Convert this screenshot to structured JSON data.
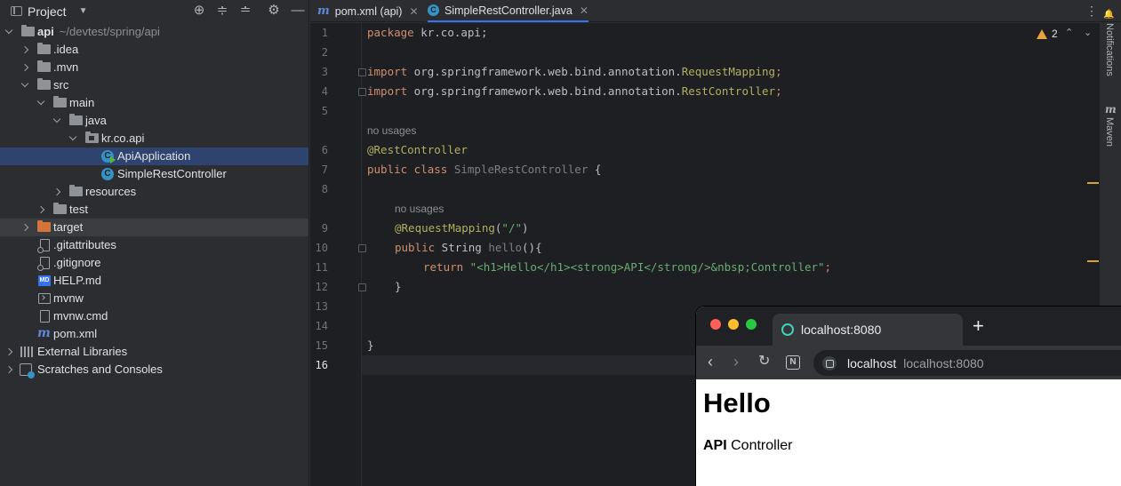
{
  "project_panel": {
    "title": "Project",
    "tree": [
      {
        "label": "api",
        "extra": "~/devtest/spring/api"
      },
      {
        "label": ".idea"
      },
      {
        "label": ".mvn"
      },
      {
        "label": "src"
      },
      {
        "label": "main"
      },
      {
        "label": "java"
      },
      {
        "label": "kr.co.api"
      },
      {
        "label": "ApiApplication"
      },
      {
        "label": "SimpleRestController"
      },
      {
        "label": "resources"
      },
      {
        "label": "test"
      },
      {
        "label": "target"
      },
      {
        "label": ".gitattributes"
      },
      {
        "label": ".gitignore"
      },
      {
        "label": "HELP.md"
      },
      {
        "label": "mvnw"
      },
      {
        "label": "mvnw.cmd"
      },
      {
        "label": "pom.xml"
      },
      {
        "label": "External Libraries"
      },
      {
        "label": "Scratches and Consoles"
      }
    ]
  },
  "tabs": [
    {
      "label": "pom.xml (api)",
      "icon": "maven-icon"
    },
    {
      "label": "SimpleRestController.java",
      "icon": "class-icon"
    }
  ],
  "editor": {
    "warning_count": "2",
    "line_numbers": [
      "1",
      "2",
      "3",
      "4",
      "5",
      "6",
      "7",
      "8",
      "9",
      "10",
      "11",
      "12",
      "13",
      "14",
      "15",
      "16"
    ],
    "hint_usages": "no usages",
    "lines": {
      "l1_kw": "package",
      "l1_rest": " kr.co.api;",
      "l3_kw": "import",
      "l3_pkg": " org.springframework.web.bind.annotation.",
      "l3_cls": "RequestMapping",
      "l3_end": ";",
      "l4_kw": "import",
      "l4_pkg": " org.springframework.web.bind.annotation.",
      "l4_cls": "RestController",
      "l4_end": ";",
      "l6_ann": "@RestController",
      "l7_kw": "public class",
      "l7_cls": " SimpleRestController",
      "l7_end": " {",
      "l9_ann": "@RequestMapping",
      "l9_open": "(",
      "l9_str": "\"/\"",
      "l9_close": ")",
      "l10_kw": "public",
      "l10_type": " String ",
      "l10_fn": "hello",
      "l10_end": "(){",
      "l11_kw": "return",
      "l11_str": " \"<h1>Hello</h1><strong>API</strong/>&nbsp;Controller\"",
      "l11_end": ";",
      "l12": "}",
      "l15": "}"
    }
  },
  "right_sidebar": {
    "notifications": "Notifications",
    "maven": "Maven"
  },
  "browser": {
    "tab_title": "localhost:8080",
    "omnibox_host": "localhost",
    "omnibox_url": "localhost:8080",
    "page_heading": "Hello",
    "page_strong": "API",
    "page_text": " Controller"
  }
}
